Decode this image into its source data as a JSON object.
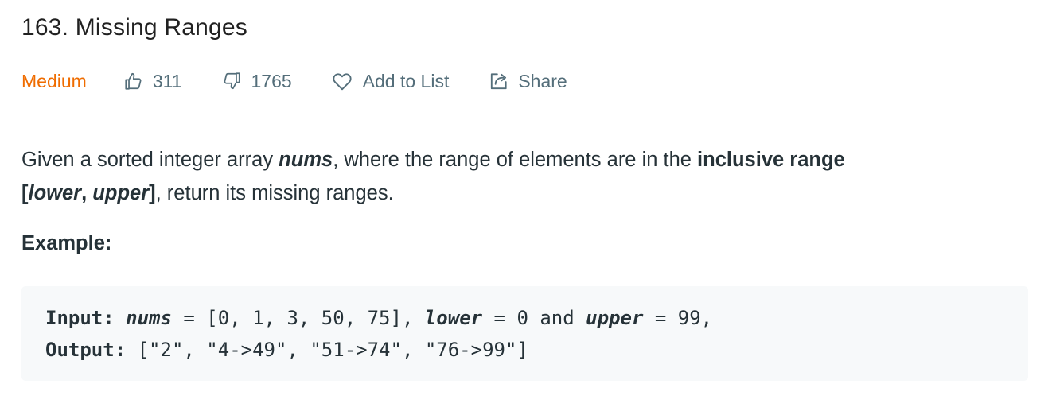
{
  "problem": {
    "title": "163. Missing Ranges",
    "difficulty": "Medium",
    "likes": "311",
    "dislikes": "1765",
    "add_to_list_label": "Add to List",
    "share_label": "Share"
  },
  "description": {
    "part1": "Given a sorted integer array ",
    "nums": "nums",
    "part2": ", where the range of elements are in the ",
    "inclusive_range": "inclusive range",
    "bracket_open": "[",
    "lower": "lower",
    "comma": ",",
    "space": " ",
    "upper": "upper",
    "bracket_close": "]",
    "part3": ", return its missing ranges."
  },
  "example": {
    "heading": "Example:",
    "input_label": "Input:",
    "input_nums_var": "nums",
    "input_nums_value": " = [0, 1, 3, 50, 75], ",
    "input_lower_var": "lower",
    "input_lower_value": " = 0 and ",
    "input_upper_var": "upper",
    "input_upper_value": " = 99,",
    "output_label": "Output:",
    "output_value": " [\"2\", \"4->49\", \"51->74\", \"76->99\"]"
  },
  "colors": {
    "difficulty_medium": "#ef6c00",
    "meta_text": "#546e7a",
    "body_text": "#263238",
    "code_background": "#f7f9fa"
  },
  "icons": {
    "likes": "thumbs-up-icon",
    "dislikes": "thumbs-down-icon",
    "add_to_list": "heart-icon",
    "share": "share-icon"
  }
}
